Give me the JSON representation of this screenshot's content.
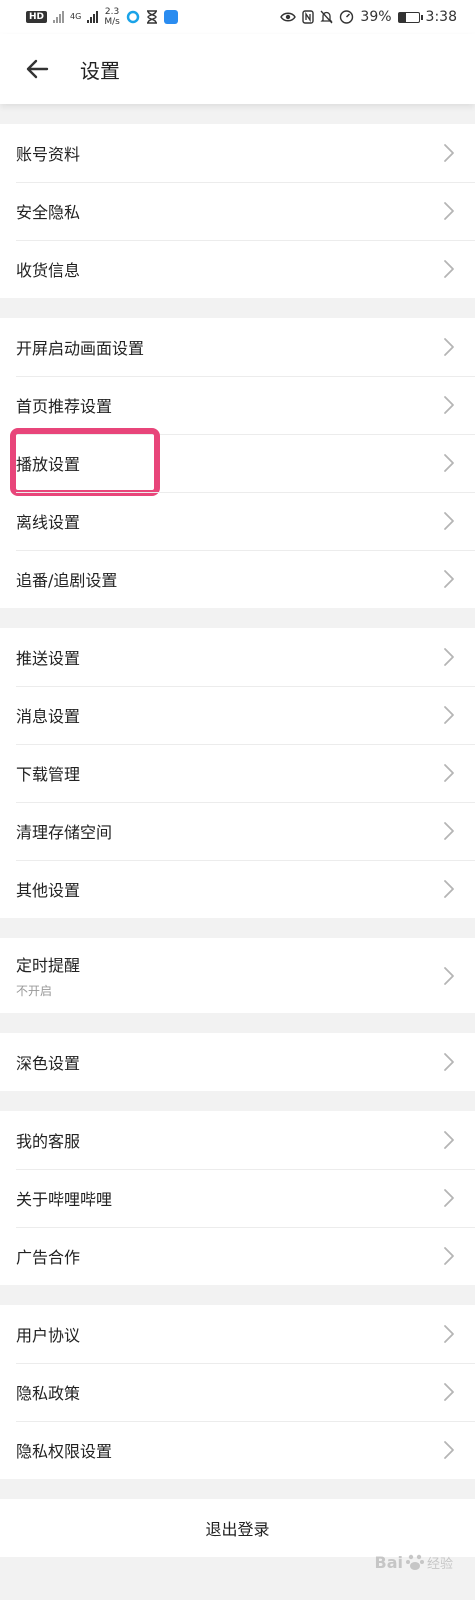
{
  "status_bar": {
    "hd_badge": "HD",
    "network": "4G",
    "speed_value": "2.3",
    "speed_unit": "M/s",
    "battery_percent": "39%",
    "battery_level": 0.39,
    "time": "3:38"
  },
  "header": {
    "title": "设置"
  },
  "groups": [
    [
      {
        "label": "账号资料"
      },
      {
        "label": "安全隐私"
      },
      {
        "label": "收货信息"
      }
    ],
    [
      {
        "label": "开屏启动画面设置"
      },
      {
        "label": "首页推荐设置"
      },
      {
        "label": "播放设置",
        "highlighted": true
      },
      {
        "label": "离线设置"
      },
      {
        "label": "追番/追剧设置"
      }
    ],
    [
      {
        "label": "推送设置"
      },
      {
        "label": "消息设置"
      },
      {
        "label": "下载管理"
      },
      {
        "label": "清理存储空间"
      },
      {
        "label": "其他设置"
      }
    ],
    [
      {
        "label": "定时提醒",
        "sub": "不开启"
      }
    ],
    [
      {
        "label": "深色设置"
      }
    ],
    [
      {
        "label": "我的客服"
      },
      {
        "label": "关于哔哩哔哩"
      },
      {
        "label": "广告合作"
      }
    ],
    [
      {
        "label": "用户协议"
      },
      {
        "label": "隐私政策"
      },
      {
        "label": "隐私权限设置"
      }
    ]
  ],
  "logout": {
    "label": "退出登录"
  },
  "watermark": {
    "brand": "Bai",
    "brand_suffix": "经验"
  },
  "colors": {
    "highlight": "#e8457a",
    "background": "#f2f2f2"
  }
}
